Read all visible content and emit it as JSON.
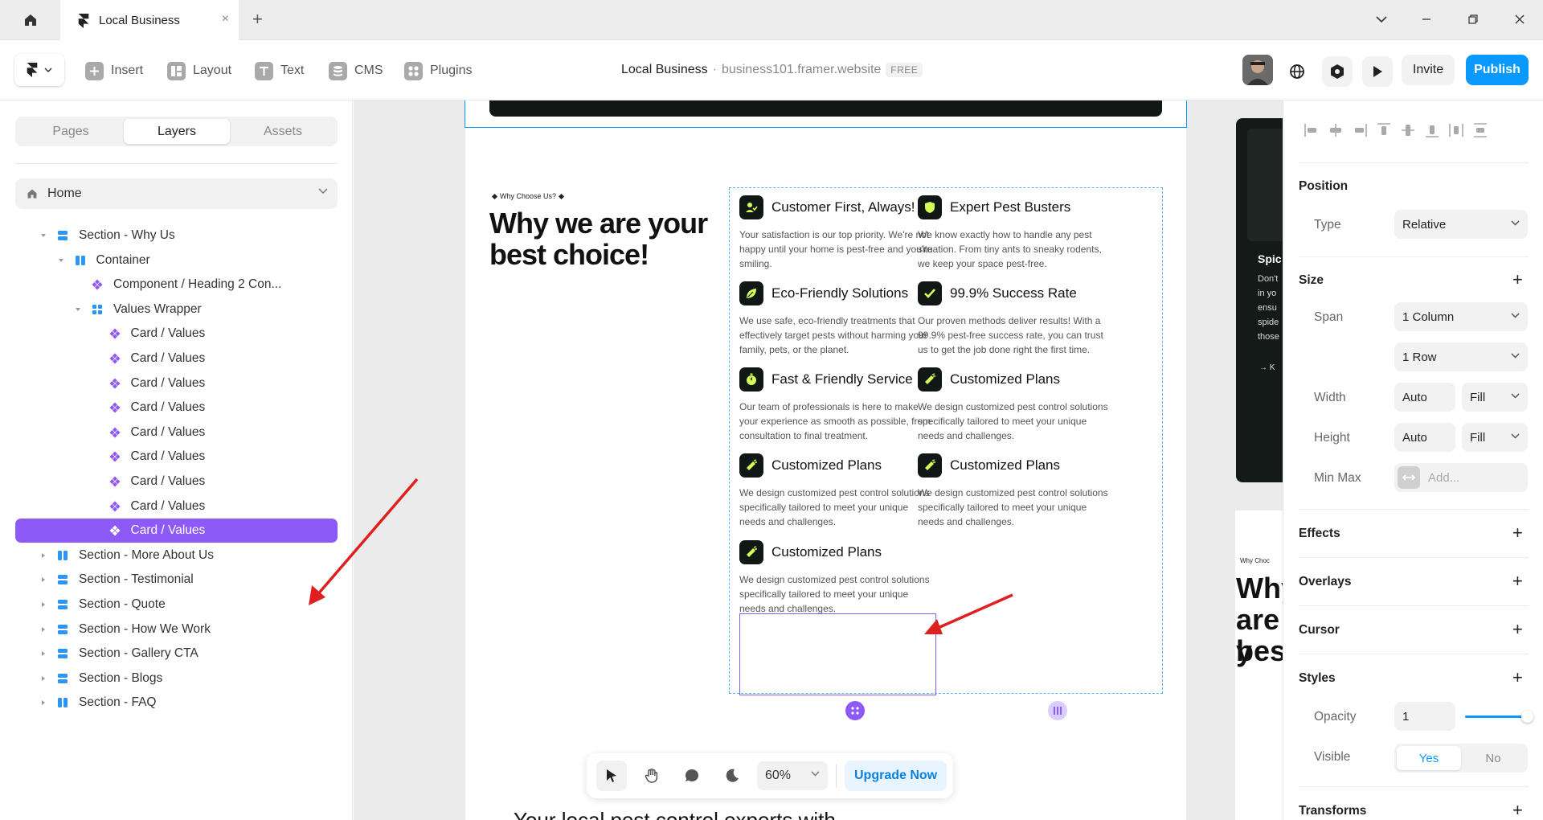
{
  "titlebar": {
    "tab_title": "Local Business",
    "tab_close": "×",
    "new_tab": "+"
  },
  "toolbar": {
    "insert": "Insert",
    "layout": "Layout",
    "text": "Text",
    "cms": "CMS",
    "plugins": "Plugins",
    "project_name": "Local Business",
    "separator": "·",
    "project_url": "business101.framer.website",
    "plan_badge": "FREE",
    "invite": "Invite",
    "publish": "Publish"
  },
  "left_panel": {
    "tabs": [
      "Pages",
      "Layers",
      "Assets"
    ],
    "active_tab": "Layers",
    "page": "Home",
    "layers": [
      {
        "label": "Section - Why Us",
        "depth": 0,
        "expanded": true,
        "icon": "stack-icon"
      },
      {
        "label": "Container",
        "depth": 1,
        "expanded": true,
        "icon": "columns-icon"
      },
      {
        "label": "Component / Heading 2 Con...",
        "depth": 2,
        "expanded": null,
        "icon": "component-icon"
      },
      {
        "label": "Values Wrapper",
        "depth": 2,
        "expanded": true,
        "icon": "grid-icon"
      },
      {
        "label": "Card / Values",
        "depth": 3,
        "expanded": null,
        "icon": "component-icon"
      },
      {
        "label": "Card / Values",
        "depth": 3,
        "expanded": null,
        "icon": "component-icon"
      },
      {
        "label": "Card / Values",
        "depth": 3,
        "expanded": null,
        "icon": "component-icon"
      },
      {
        "label": "Card / Values",
        "depth": 3,
        "expanded": null,
        "icon": "component-icon"
      },
      {
        "label": "Card / Values",
        "depth": 3,
        "expanded": null,
        "icon": "component-icon"
      },
      {
        "label": "Card / Values",
        "depth": 3,
        "expanded": null,
        "icon": "component-icon"
      },
      {
        "label": "Card / Values",
        "depth": 3,
        "expanded": null,
        "icon": "component-icon"
      },
      {
        "label": "Card / Values",
        "depth": 3,
        "expanded": null,
        "icon": "component-icon"
      },
      {
        "label": "Card / Values",
        "depth": 3,
        "expanded": null,
        "icon": "component-icon",
        "selected": true
      },
      {
        "label": "Section - More About Us",
        "depth": 0,
        "expanded": false,
        "icon": "columns-icon"
      },
      {
        "label": "Section - Testimonial",
        "depth": 0,
        "expanded": false,
        "icon": "stack-icon"
      },
      {
        "label": "Section - Quote",
        "depth": 0,
        "expanded": false,
        "icon": "stack-icon"
      },
      {
        "label": "Section - How We Work",
        "depth": 0,
        "expanded": false,
        "icon": "stack-icon"
      },
      {
        "label": "Section - Gallery CTA",
        "depth": 0,
        "expanded": false,
        "icon": "stack-icon"
      },
      {
        "label": "Section - Blogs",
        "depth": 0,
        "expanded": false,
        "icon": "stack-icon"
      },
      {
        "label": "Section - FAQ",
        "depth": 0,
        "expanded": false,
        "icon": "columns-icon"
      }
    ]
  },
  "canvas": {
    "badge": "Why Choose Us?",
    "heading": "Why we are your best choice!",
    "cards": [
      {
        "title": "Customer First, Always!",
        "desc": "Your satisfaction is our top priority. We're not happy until your home is pest-free and you're smiling.",
        "icon": "user-check-icon"
      },
      {
        "title": "Expert Pest Busters",
        "desc": "We know exactly how to handle any pest situation. From tiny ants to sneaky rodents, we keep your space pest-free.",
        "icon": "shield-icon"
      },
      {
        "title": "Eco-Friendly Solutions",
        "desc": "We use safe, eco-friendly treatments that effectively target pests without harming your family, pets, or the planet.",
        "icon": "leaf-icon"
      },
      {
        "title": "99.9% Success Rate",
        "desc": "Our proven methods deliver results! With a 99.9% pest-free success rate, you can trust us to get the job done right the first time.",
        "icon": "check-icon"
      },
      {
        "title": "Fast & Friendly Service",
        "desc": "Our team of professionals is here to make your experience as smooth as possible, from consultation to final treatment.",
        "icon": "stopwatch-icon"
      },
      {
        "title": "Customized Plans",
        "desc": "We design customized pest control solutions specifically tailored to meet your unique needs and challenges.",
        "icon": "spray-icon"
      },
      {
        "title": "Customized Plans",
        "desc": "We design customized pest control solutions specifically tailored to meet your unique needs and challenges.",
        "icon": "spray-icon"
      },
      {
        "title": "Customized Plans",
        "desc": "We design customized pest control solutions specifically tailored to meet your unique needs and challenges.",
        "icon": "spray-icon"
      },
      {
        "title": "Customized Plans",
        "desc": "We design customized pest control solutions specifically tailored to meet your unique needs and challenges.",
        "icon": "spray-icon"
      }
    ],
    "bottom_heading": "Your local pest control experts with",
    "preview_texts": [
      "Spic",
      "Don't",
      "in yo",
      "ensu",
      "spide",
      "those",
      "→ K"
    ],
    "preview_badge": "Why Choc",
    "preview_heading": [
      "Why",
      "are y",
      "best"
    ]
  },
  "canvas_toolbar": {
    "zoom": "60%",
    "upgrade": "Upgrade Now"
  },
  "right_panel": {
    "position": {
      "title": "Position",
      "type_label": "Type",
      "type_value": "Relative"
    },
    "size": {
      "title": "Size",
      "span_label": "Span",
      "span_col": "1 Column",
      "span_row": "1 Row",
      "width_label": "Width",
      "width_value": "Auto",
      "width_mode": "Fill",
      "height_label": "Height",
      "height_value": "Auto",
      "height_mode": "Fill",
      "minmax_label": "Min Max",
      "minmax_placeholder": "Add..."
    },
    "effects": "Effects",
    "overlays": "Overlays",
    "cursor": "Cursor",
    "styles": {
      "title": "Styles",
      "opacity_label": "Opacity",
      "opacity_value": "1",
      "visible_label": "Visible",
      "yes": "Yes",
      "no": "No"
    },
    "transforms": "Transforms",
    "plus": "+"
  },
  "colors": {
    "accent": "#0a99ff",
    "selection": "#8d59f7",
    "icon_bg": "#111715",
    "icon_fg": "#d4ff5a",
    "annotation": "#e02020"
  }
}
